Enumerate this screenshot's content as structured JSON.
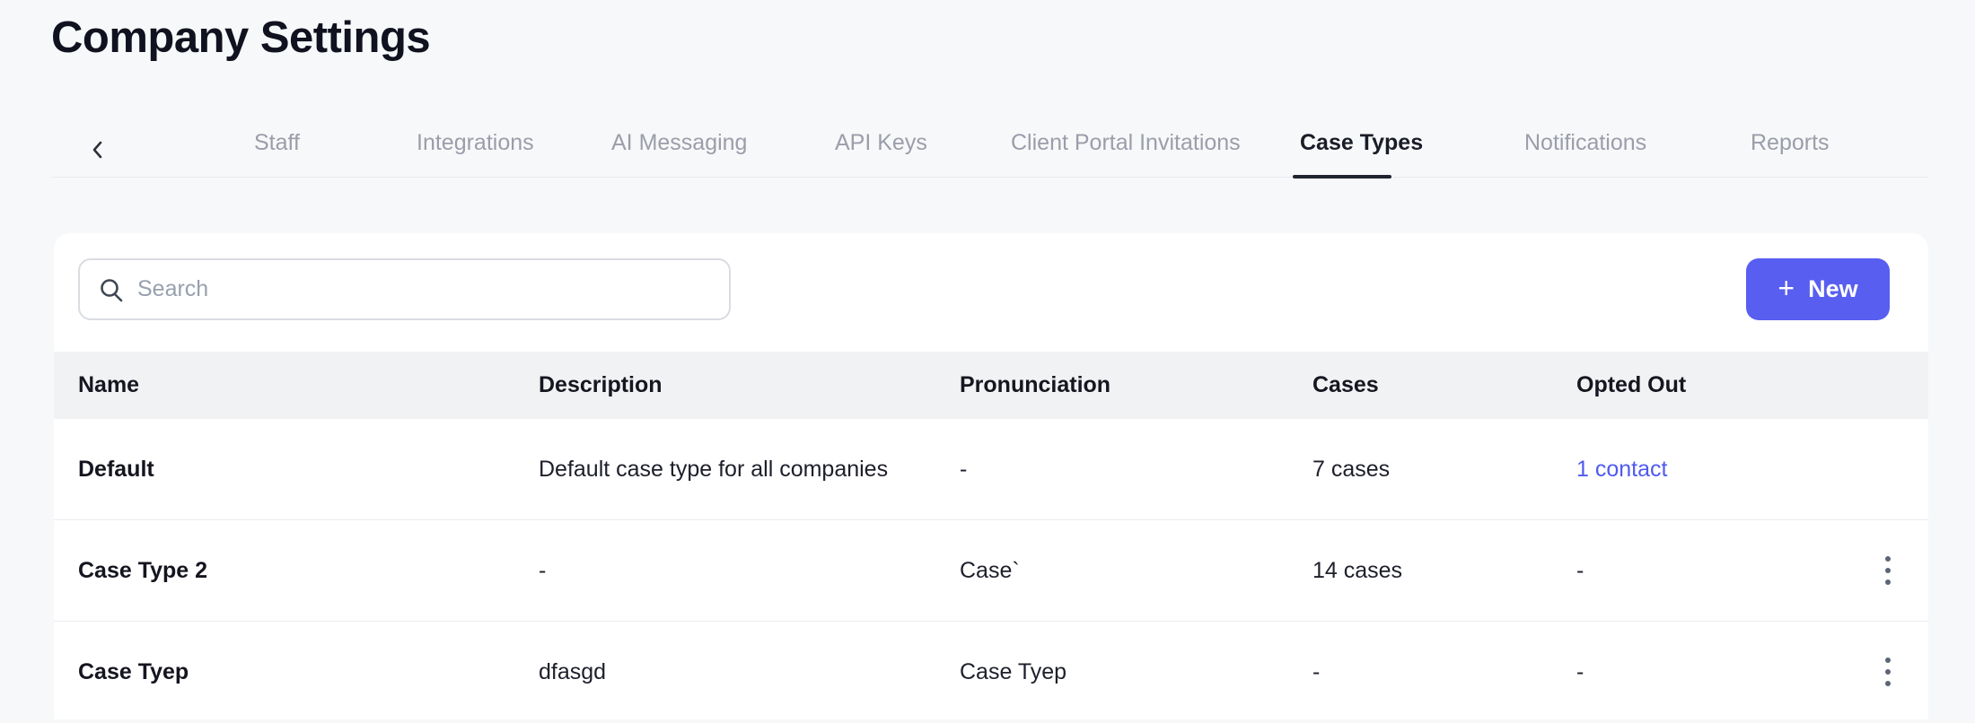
{
  "page": {
    "title": "Company Settings"
  },
  "tabs": {
    "items": [
      {
        "label": "Staff",
        "active": false
      },
      {
        "label": "Integrations",
        "active": false
      },
      {
        "label": "AI Messaging",
        "active": false
      },
      {
        "label": "API Keys",
        "active": false
      },
      {
        "label": "Client Portal Invitations",
        "active": false
      },
      {
        "label": "Case Types",
        "active": true
      },
      {
        "label": "Notifications",
        "active": false
      },
      {
        "label": "Reports",
        "active": false
      }
    ]
  },
  "toolbar": {
    "search_placeholder": "Search",
    "new_button_plus": "+",
    "new_button_label": "New"
  },
  "table": {
    "columns": [
      "Name",
      "Description",
      "Pronunciation",
      "Cases",
      "Opted Out"
    ],
    "rows": [
      {
        "name": "Default",
        "description": "Default case type for all companies",
        "pronunciation": "-",
        "cases": "7 cases",
        "opted_out": "1 contact",
        "opted_out_is_link": true,
        "has_menu": false
      },
      {
        "name": "Case Type 2",
        "description": "-",
        "pronunciation": "Case`",
        "cases": "14 cases",
        "opted_out": "-",
        "opted_out_is_link": false,
        "has_menu": true
      },
      {
        "name": "Case Tyep",
        "description": "dfasgd",
        "pronunciation": "Case Tyep",
        "cases": "-",
        "opted_out": "-",
        "opted_out_is_link": false,
        "has_menu": true
      }
    ]
  },
  "colors": {
    "accent_button": "#585ef0",
    "link": "#4f5aef",
    "active_tab": "#1a1c27",
    "inactive_tab": "#9b9daa",
    "page_background": "#f7f8f9",
    "header_row_background": "#f1f2f4"
  }
}
